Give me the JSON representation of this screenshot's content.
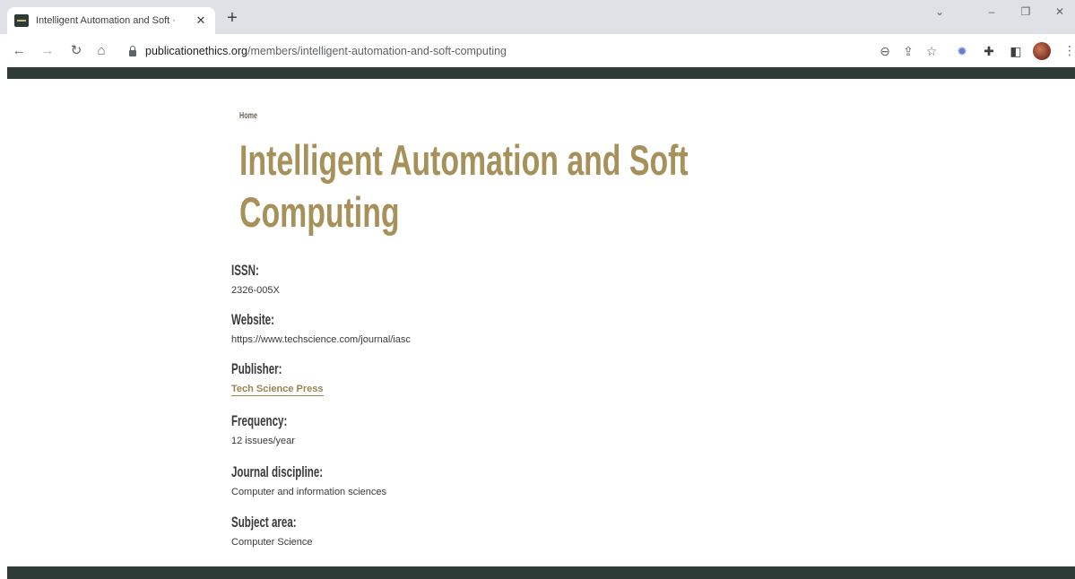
{
  "browser": {
    "tab_title": "Intelligent Automation and Soft ·",
    "new_tab_label": "+",
    "url_host": "publicationethics.org",
    "url_path": "/members/intelligent-automation-and-soft-computing",
    "icons": [
      "back-icon",
      "forward-icon",
      "reload-icon",
      "home-icon",
      "lock-icon",
      "zoom-icon",
      "share-icon",
      "bookmark-star-icon",
      "extension-icon",
      "puzzle-icon",
      "sidepanel-icon",
      "profile-avatar",
      "menu-icon"
    ]
  },
  "page": {
    "breadcrumb": "Home",
    "title": "Intelligent Automation and Soft Computing",
    "fields": {
      "issn_label": "ISSN:",
      "issn_value": "2326-005X",
      "website_label": "Website:",
      "website_value": "https://www.techscience.com/journal/iasc",
      "publisher_label": "Publisher:",
      "publisher_value": "Tech Science Press",
      "frequency_label": "Frequency:",
      "frequency_value": "12 issues/year",
      "discipline_label": "Journal discipline:",
      "discipline_value": "Computer and information sciences",
      "subject_label": "Subject area:",
      "subject_value": "Computer Science"
    }
  },
  "colors": {
    "title_gold": "#a6915a",
    "bar_dark": "#2e3a36",
    "link_gold": "#9a8550"
  }
}
